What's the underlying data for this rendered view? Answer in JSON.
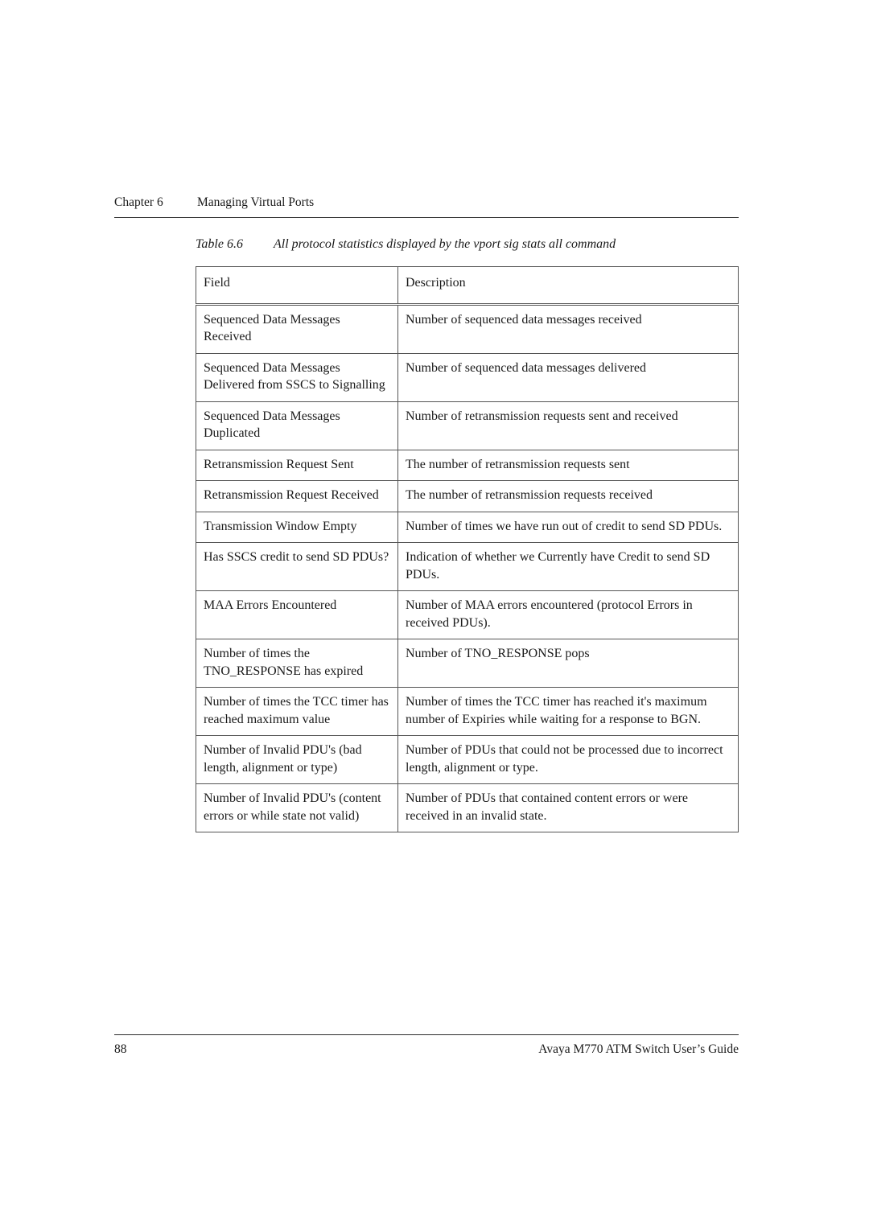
{
  "document": {
    "running_head": {
      "chapter_label": "Chapter 6",
      "chapter_title": "Managing Virtual Ports"
    },
    "table_caption": {
      "number": "Table 6.6",
      "text": "All protocol statistics displayed by the vport sig stats all command"
    },
    "table": {
      "headers": [
        "Field",
        "Description"
      ],
      "rows": [
        {
          "field": "Sequenced Data Messages Received",
          "description": "Number of sequenced data messages received"
        },
        {
          "field": "Sequenced Data Messages Delivered from SSCS to Signalling",
          "description": "Number of sequenced data messages delivered"
        },
        {
          "field": "Sequenced Data Messages Duplicated",
          "description": "Number of retransmission requests sent and received"
        },
        {
          "field": "Retransmission Request Sent",
          "description": "The number of retransmission requests sent"
        },
        {
          "field": "Retransmission Request Received",
          "description": "The number of retransmission requests received"
        },
        {
          "field": "Transmission Window Empty",
          "description": "Number of times we have run out of credit to send SD PDUs."
        },
        {
          "field": "Has SSCS credit to send SD PDUs?",
          "description": "Indication of whether we Currently have Credit to send SD PDUs."
        },
        {
          "field": "MAA Errors Encountered",
          "description": "Number of MAA errors encountered (protocol Errors in received PDUs)."
        },
        {
          "field": "Number of times the TNO_RESPONSE has expired",
          "description": "Number of TNO_RESPONSE pops"
        },
        {
          "field": "Number of times the TCC timer has reached maximum value",
          "description": "Number of times the TCC timer has reached it's maximum number of Expiries while waiting for a response to BGN."
        },
        {
          "field": "Number of Invalid PDU's (bad length, alignment or type)",
          "description": "Number of PDUs that could not be processed due to incorrect length, alignment or type."
        },
        {
          "field": "Number of Invalid PDU's (content errors or while state not valid)",
          "description": "Number of PDUs that contained content errors or were received in an invalid state."
        }
      ]
    },
    "footer": {
      "page_number": "88",
      "book_title": "Avaya M770 ATM Switch User’s Guide"
    },
    "colors": {
      "page_background": "#ffffff",
      "text": "#1a1a1a",
      "rule": "#2b2b2b",
      "table_border": "#555555"
    }
  }
}
